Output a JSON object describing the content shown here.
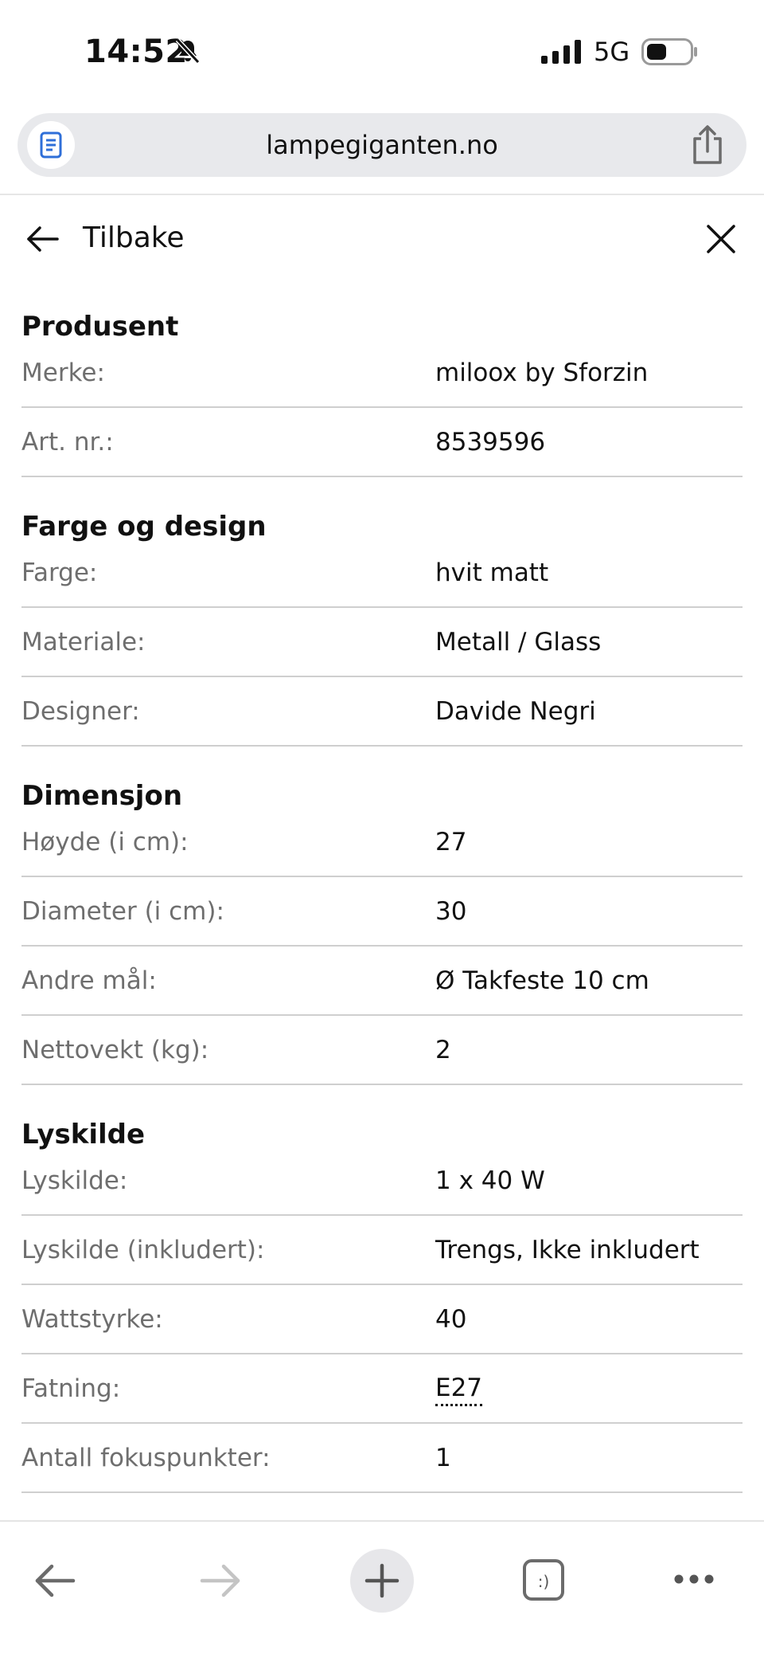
{
  "status_bar": {
    "time": "14:52",
    "network": "5G"
  },
  "browser": {
    "url": "lampegiganten.no"
  },
  "header": {
    "back_label": "Tilbake"
  },
  "sections": [
    {
      "title": "Produsent",
      "rows": [
        {
          "label": "Merke:",
          "value": "miloox by Sforzin"
        },
        {
          "label": "Art. nr.:",
          "value": "8539596"
        }
      ]
    },
    {
      "title": "Farge og design",
      "rows": [
        {
          "label": "Farge:",
          "value": "hvit matt"
        },
        {
          "label": "Materiale:",
          "value": "Metall / Glass"
        },
        {
          "label": "Designer:",
          "value": "Davide Negri"
        }
      ]
    },
    {
      "title": "Dimensjon",
      "rows": [
        {
          "label": "Høyde (i cm):",
          "value": "27"
        },
        {
          "label": "Diameter (i cm):",
          "value": "30"
        },
        {
          "label": "Andre mål:",
          "value": "Ø Takfeste 10 cm"
        },
        {
          "label": "Nettovekt (kg):",
          "value": "2"
        }
      ]
    },
    {
      "title": "Lyskilde",
      "rows": [
        {
          "label": "Lyskilde:",
          "value": "1 x 40 W"
        },
        {
          "label": "Lyskilde (inkludert):",
          "value": "Trengs, Ikke inkludert"
        },
        {
          "label": "Wattstyrke:",
          "value": "40"
        },
        {
          "label": "Fatning:",
          "value": "E27"
        },
        {
          "label": "Antall fokuspunkter:",
          "value": "1"
        }
      ]
    }
  ],
  "toolbar": {
    "tabs_icon_glyph": ":)"
  },
  "icons": [
    "bell-muted-icon",
    "signal-icon",
    "battery-icon",
    "page-icon",
    "share-icon",
    "back-arrow-icon",
    "close-icon",
    "forward-arrow-icon",
    "plus-icon",
    "tabs-icon",
    "more-icon"
  ],
  "colors": {
    "label_gray": "#6e6e6e",
    "divider": "#cfcfcf",
    "url_bar_bg": "#e8e9ec",
    "page_icon_blue": "#2f6fd8"
  }
}
